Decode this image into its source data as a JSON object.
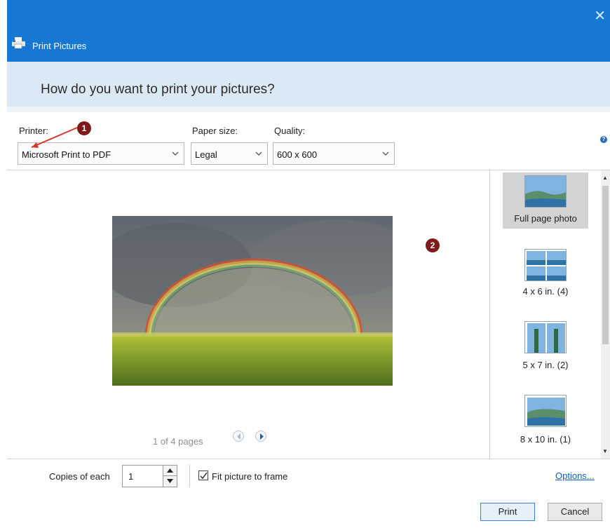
{
  "window": {
    "title": "Print Pictures",
    "close_glyph": "✕"
  },
  "header": {
    "question": "How do you want to print your pictures?"
  },
  "options": {
    "printer_label": "Printer:",
    "printer_value": "Microsoft Print to PDF",
    "paper_size_label": "Paper size:",
    "paper_size_value": "Legal",
    "quality_label": "Quality:",
    "quality_value": "600 x 600",
    "help_glyph": "?"
  },
  "annotations": {
    "badge1": "1",
    "badge2": "2",
    "accent": "#7e1a1a",
    "arrow_color": "#d9342b"
  },
  "preview": {
    "pager_text": "1 of 4 pages"
  },
  "layouts": [
    {
      "label": "Full page photo",
      "selected": true,
      "icon": "full-page-photo-icon"
    },
    {
      "label": "4 x 6 in. (4)",
      "selected": false,
      "icon": "four-by-six-icon"
    },
    {
      "label": "5 x 7 in. (2)",
      "selected": false,
      "icon": "five-by-seven-icon"
    },
    {
      "label": "8 x 10 in. (1)",
      "selected": false,
      "icon": "eight-by-ten-icon"
    }
  ],
  "bottom": {
    "copies_label": "Copies of each",
    "copies_value": "1",
    "fit_label": "Fit picture to frame",
    "fit_checked": true,
    "options_link": "Options...",
    "print_button": "Print",
    "cancel_button": "Cancel"
  },
  "colors": {
    "titlebar": "#1678d2",
    "header_band": "#dbe9f6",
    "link": "#1660b8"
  }
}
